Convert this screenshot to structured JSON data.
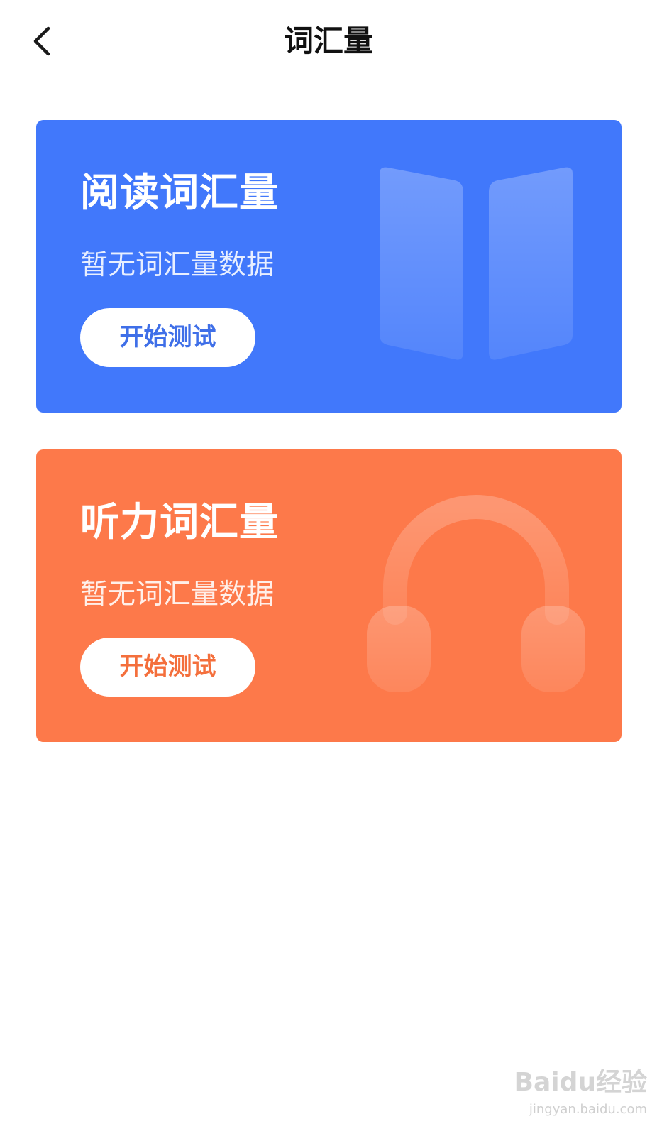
{
  "header": {
    "title": "词汇量",
    "back_icon": "chevron-left-icon"
  },
  "cards": {
    "reading": {
      "title": "阅读词汇量",
      "status": "暂无词汇量数据",
      "button_label": "开始测试",
      "background_color": "#4178fb",
      "icon": "open-book-icon"
    },
    "listening": {
      "title": "听力词汇量",
      "status": "暂无词汇量数据",
      "button_label": "开始测试",
      "background_color": "#fd794a",
      "icon": "headphones-icon"
    }
  },
  "watermark": {
    "logo": "Baidu经验",
    "url": "jingyan.baidu.com"
  }
}
